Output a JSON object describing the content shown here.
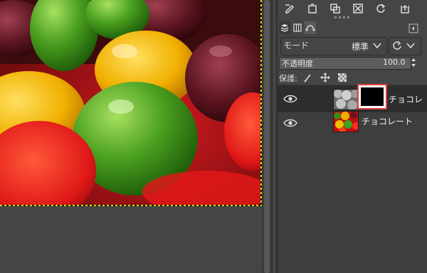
{
  "toolbar": {
    "icons": [
      "edit-icon",
      "new-layer-icon",
      "duplicate-icon",
      "delete-icon",
      "refresh-icon",
      "export-icon"
    ]
  },
  "tabs": [
    "layers-tab",
    "channels-tab",
    "paths-tab"
  ],
  "mode": {
    "label": "モード",
    "value": "標準"
  },
  "opacity": {
    "label": "不透明度",
    "value": "100.0",
    "percent": 100
  },
  "protect": {
    "label": "保護:"
  },
  "layers": [
    {
      "name": "チョコレ",
      "selected": true,
      "has_mask": true
    },
    {
      "name": "チョコレート",
      "selected": false,
      "has_mask": false
    }
  ],
  "colors": {
    "panel_bg": "#454545",
    "selected_row": "#2d2d2d",
    "mask_highlight": "#e04040"
  }
}
